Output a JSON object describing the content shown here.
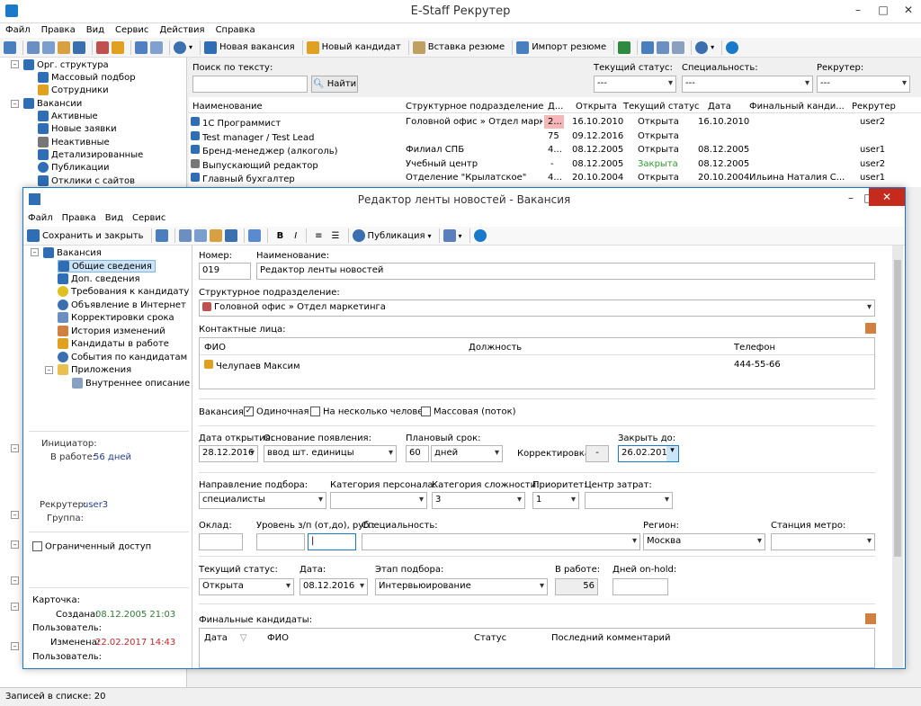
{
  "app": {
    "title": "E-Staff Рекрутер"
  },
  "menu": [
    "Файл",
    "Правка",
    "Вид",
    "Сервис",
    "Действия",
    "Справка"
  ],
  "toolbar": {
    "new_vacancy": "Новая вакансия",
    "new_candidate": "Новый кандидат",
    "insert_resume": "Вставка резюме",
    "import_resume": "Импорт резюме"
  },
  "sidebar": {
    "items": [
      {
        "label": "Орг. структура",
        "color": "#2f6db5"
      },
      {
        "label": "Массовый подбор",
        "color": "#2f6db5"
      },
      {
        "label": "Сотрудники",
        "color": "#e0a020"
      },
      {
        "label": "Вакансии",
        "color": "#2f6db5"
      },
      {
        "label": "Активные",
        "color": "#2f6db5"
      },
      {
        "label": "Новые заявки",
        "color": "#2f6db5"
      },
      {
        "label": "Неактивные",
        "color": "#777"
      },
      {
        "label": "Детализированные",
        "color": "#2f6db5"
      },
      {
        "label": "Публикации",
        "color": "#2f6db5"
      },
      {
        "label": "Отклики с сайтов",
        "color": "#2f6db5"
      }
    ]
  },
  "search": {
    "label": "Поиск по тексту:",
    "button": "Найти",
    "status_label": "Текущий статус:",
    "status_value": "---",
    "spec_label": "Специальность:",
    "spec_value": "---",
    "recruiter_label": "Рекрутер:",
    "recruiter_value": "---"
  },
  "grid": {
    "headers": [
      "Наименование",
      "Структурное подразделение",
      "Д...",
      "Открыта",
      "Текущий статус",
      "Дата",
      "Финальный канди...",
      "Рекрутер"
    ],
    "rows": [
      [
        "1С Программист",
        "Головной офис » Отдел марке...",
        "2...",
        "16.10.2010",
        "Открыта",
        "16.10.2010",
        "",
        "user2"
      ],
      [
        "Test manager / Test Lead",
        "",
        "75",
        "09.12.2016",
        "Открыта",
        "",
        "",
        ""
      ],
      [
        "Бренд-менеджер (алкоголь)",
        "Филиал СПБ",
        "4...",
        "08.12.2005",
        "Открыта",
        "08.12.2005",
        "",
        "user1"
      ],
      [
        "Выпускающий редактор",
        "Учебный центр",
        "-",
        "08.12.2005",
        "Закрыта",
        "08.12.2005",
        "",
        "user2"
      ],
      [
        "Главный бухгалтер",
        "Отделение \"Крылатское\"",
        "4...",
        "20.10.2004",
        "Открыта",
        "20.10.2004",
        "Ильина Наталия С...",
        "user1"
      ]
    ]
  },
  "statusbar": {
    "text": "Записей в списке: 20"
  },
  "dialog": {
    "title": "Редактор ленты новостей - Вакансия",
    "menu": [
      "Файл",
      "Правка",
      "Вид",
      "Сервис"
    ],
    "save_close": "Сохранить и закрыть",
    "publication": "Публикация",
    "tree": [
      "Вакансия",
      "Общие сведения",
      "Доп. сведения",
      "Требования к кандидату",
      "Объявление в Интернет",
      "Корректировки срока",
      "История изменений",
      "Кандидаты в работе",
      "События по кандидатам",
      "Приложения",
      "Внутреннее описание"
    ],
    "initiator_label": "Инициатор:",
    "in_work_label": "В работе:",
    "in_work_value": "56 дней",
    "recruiter_label": "Рекрутер:",
    "recruiter_value": "user3",
    "group_label": "Группа:",
    "restricted_label": "Ограниченный доступ",
    "card_label": "Карточка:",
    "created_label": "Создана:",
    "created_value": "08.12.2005 21:03",
    "user_label1": "Пользователь:",
    "changed_label": "Изменена:",
    "changed_value": "22.02.2017 14:43",
    "user_label2": "Пользователь:",
    "number_label": "Номер:",
    "number_value": "019",
    "name_label": "Наименование:",
    "name_value": "Редактор ленты новостей",
    "division_label": "Структурное подразделение:",
    "division_value": "Головной офис » Отдел маркетинга",
    "contacts_label": "Контактные лица:",
    "contacts_headers": [
      "ФИО",
      "Должность",
      "Телефон"
    ],
    "contact": {
      "name": "Челупаев Максим",
      "position": "",
      "phone": "444-55-66"
    },
    "vacancy_label": "Вакансия:",
    "opt_single": "Одиночная",
    "opt_multi": "На несколько человек",
    "opt_mass": "Массовая (поток)",
    "open_date_label": "Дата открытия:",
    "open_date": "28.12.2016",
    "reason_label": "Основание появления:",
    "reason_value": "ввод шт. единицы",
    "plan_label": "Плановый срок:",
    "plan_value": "60",
    "plan_unit": "дней",
    "correction_label": "Корректировка:",
    "correction_value": "-",
    "close_label": "Закрыть до:",
    "close_value": "26.02.2017",
    "direction_label": "Направление подбора:",
    "direction_value": "специалисты",
    "staff_cat_label": "Категория персонала:",
    "staff_cat_value": "",
    "diff_label": "Категория сложности:",
    "diff_value": "3",
    "priority_label": "Приоритет:",
    "priority_value": "1",
    "cost_label": "Центр затрат:",
    "cost_value": "",
    "salary_label": "Оклад:",
    "level_label": "Уровень з/п (от,до), руб.:",
    "spec_label": "Специальность:",
    "region_label": "Регион:",
    "region_value": "Москва",
    "metro_label": "Станция метро:",
    "cur_status_label": "Текущий статус:",
    "cur_status_value": "Открыта",
    "date_label": "Дата:",
    "date_value": "08.12.2016",
    "stage_label": "Этап подбора:",
    "stage_value": "Интервьюирование",
    "inwork_label": "В работе:",
    "inwork_value": "56",
    "onhold_label": "Дней on-hold:",
    "final_label": "Финальные кандидаты:",
    "final_headers": [
      "Дата",
      "ФИО",
      "Статус",
      "Последний комментарий"
    ]
  },
  "colors": {
    "accent": "#1979ca",
    "closed": "#2e9a2e",
    "highlight": "#f4b6b6",
    "date_green": "#2e7d32",
    "date_red": "#c62828"
  }
}
